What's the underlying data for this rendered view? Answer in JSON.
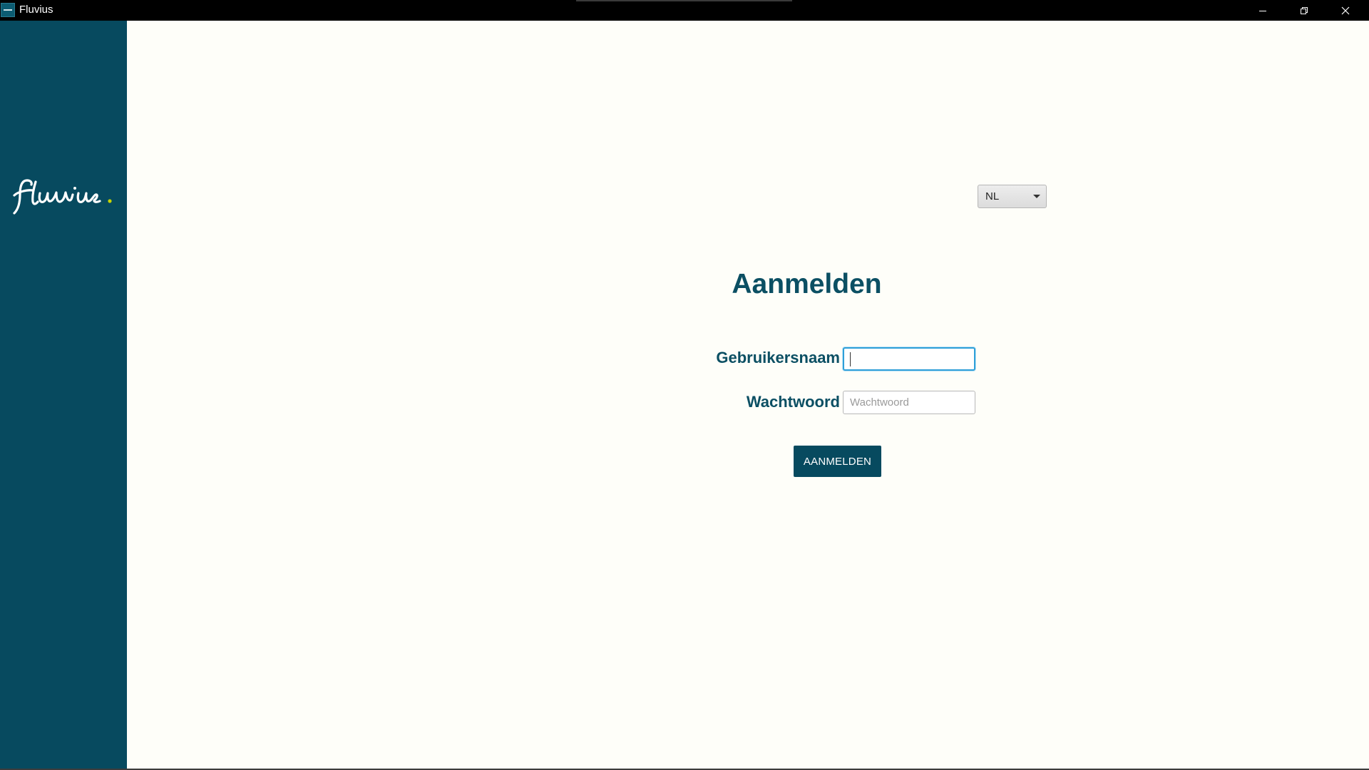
{
  "window": {
    "title": "Fluvius",
    "controls": {
      "minimize": "minimize-icon",
      "maximize": "restore-icon",
      "close": "close-icon"
    }
  },
  "sidebar": {
    "logo_text": "fluvius.",
    "logo_icon": "fluvius-logo"
  },
  "login": {
    "language": {
      "selected": "NL"
    },
    "heading": "Aanmelden",
    "username": {
      "label": "Gebruikersnaam",
      "value": "",
      "placeholder": ""
    },
    "password": {
      "label": "Wachtwoord",
      "value": "",
      "placeholder": "Wachtwoord"
    },
    "submit_label": "AANMELDEN"
  },
  "colors": {
    "brand": "#074a5f",
    "background": "#fefef9",
    "focus": "#2e9fd8",
    "logo_dot": "#c6d300"
  }
}
